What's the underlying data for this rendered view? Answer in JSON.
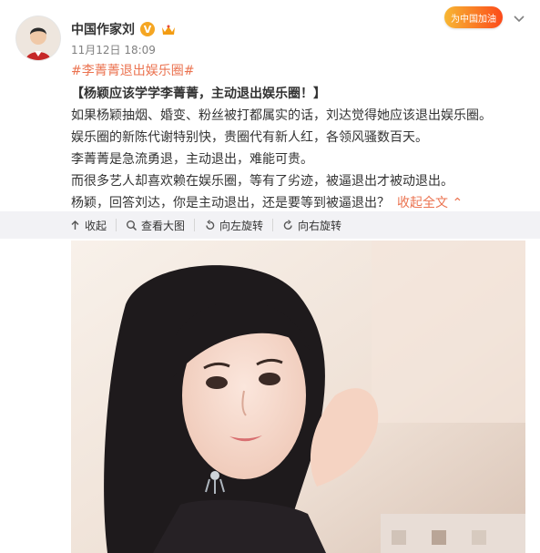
{
  "header": {
    "username": "中国作家刘",
    "verify_mark": "V",
    "timestamp": "11月12日 18:09",
    "campaign_badge": "为中国加油"
  },
  "post": {
    "hashtag": "#李菁菁退出娱乐圈#",
    "lines": [
      "【杨颖应该学学李菁菁，主动退出娱乐圈！】",
      "如果杨颖抽烟、婚变、粉丝被打都属实的话，刘达觉得她应该退出娱乐圈。",
      "娱乐圈的新陈代谢特别快，贵圈代有新人红，各领风骚数百天。",
      "李菁菁是急流勇退，主动退出，难能可贵。",
      "而很多艺人却喜欢赖在娱乐圈，等有了劣迹，被逼退出才被动退出。",
      "杨颖，回答刘达，你是主动退出，还是要等到被逼退出？"
    ],
    "collapse_label": "收起全文"
  },
  "actions": {
    "collapse": "收起",
    "view_full": "查看大图",
    "rotate_left": "向左旋转",
    "rotate_right": "向右旋转"
  },
  "icons": {
    "avatar": "user-avatar",
    "verified": "verified-badge-icon",
    "vip": "vip-icon",
    "more": "chevron-down-icon",
    "collapse": "arrow-up-icon",
    "zoom": "magnifier-icon",
    "rotate_left": "rotate-left-icon",
    "rotate_right": "rotate-right-icon"
  },
  "colors": {
    "link": "#eb7350",
    "text": "#333333",
    "meta": "#808080",
    "action_bar": "#f2f2f5",
    "verify": "#f5a623"
  }
}
